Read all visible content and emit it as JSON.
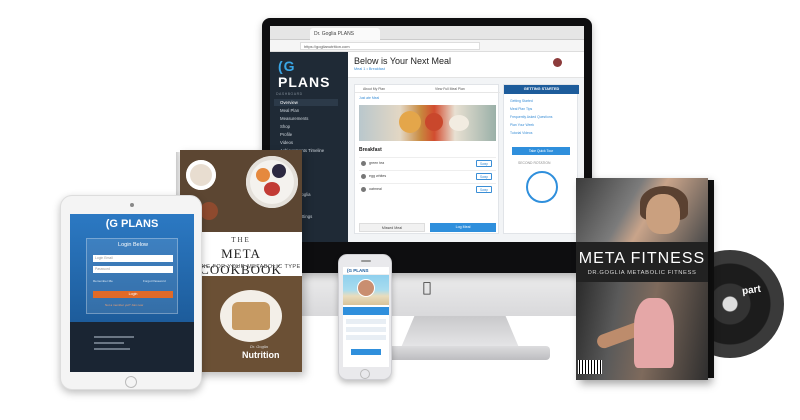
{
  "imac": {
    "browser_tab": "Dr. Goglia PLANS",
    "url": "https://goglianutrition.com",
    "logo_prefix": "(G",
    "logo_text": "PLANS",
    "page_title": "Below is Your Next Meal",
    "page_subtitle": "Meal 1 • Breakfast",
    "sidebar": {
      "section_dashboard": "DASHBOARD",
      "items_top": [
        "Overview",
        "Meal Plan",
        "Measurements",
        "Shop",
        "Profile",
        "Videos",
        "Achievements Timeline"
      ],
      "section_extras": "EXTRAS",
      "items_mid": [
        "Recipes",
        "Fitness",
        "Resources",
        "About Dr Goglia"
      ],
      "section_account": "ACCOUNT",
      "items_bottom": [
        "Account Settings",
        "Support"
      ]
    },
    "meal_tabs": [
      "About My Plan",
      "View Full Meal Plan"
    ],
    "meal_link": "Just ate Meal",
    "meal_name": "Breakfast",
    "ingredients": [
      {
        "name": "green tea"
      },
      {
        "name": "egg whites"
      },
      {
        "name": "oatmeal"
      }
    ],
    "swap_label": "Swap",
    "missed_label": "Missed Meal",
    "log_label": "Log Meal",
    "getting_started": {
      "header": "GETTING STARTED",
      "links": [
        "Getting Started",
        "Meal Plan Tips",
        "Frequently Asked Questions",
        "Plan Your Week",
        "Tutorial Videos"
      ],
      "button": "Take Quick Tour",
      "footer": "SECOND ROTATION"
    }
  },
  "cookbook": {
    "the": "THE",
    "title": "META COOKBOOK",
    "subtitle": "COOKING FOR YOUR METABOLIC TYPE",
    "brand_small": "Dr. Goglia",
    "brand": "Nutrition"
  },
  "tablet": {
    "logo": "(G PLANS",
    "login_title": "Login Below",
    "field_email": "Login Email",
    "field_password": "Password",
    "remember": "Remember Me",
    "forgot": "Forgot Password",
    "login_button": "Login",
    "signup": "Not a member yet? Join now"
  },
  "phone": {
    "header": "(G PLANS"
  },
  "dvd": {
    "title": "META FITNESS",
    "subtitle": "DR.GOGLIA METABOLIC FITNESS",
    "disc_text": "part"
  },
  "colors": {
    "accent_blue": "#2f8fdc",
    "sidebar_dark": "#1f2a36",
    "login_orange": "#e06a28"
  }
}
